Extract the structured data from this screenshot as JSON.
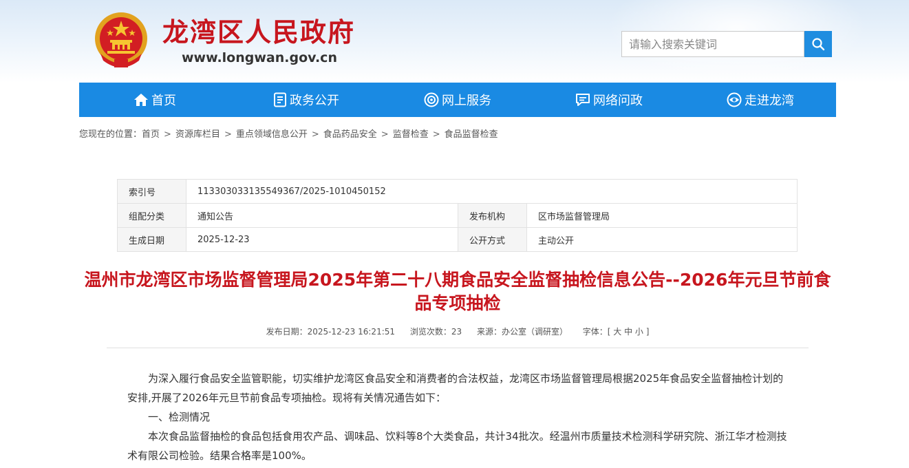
{
  "header": {
    "site_title": "龙湾区人民政府",
    "site_url": "www.longwan.gov.cn"
  },
  "search": {
    "placeholder": "请输入搜索关键词"
  },
  "nav": {
    "items": [
      {
        "label": "首页",
        "icon": "home-icon"
      },
      {
        "label": "政务公开",
        "icon": "document-icon"
      },
      {
        "label": "网上服务",
        "icon": "service-icon"
      },
      {
        "label": "网络问政",
        "icon": "chat-icon"
      },
      {
        "label": "走进龙湾",
        "icon": "eye-icon"
      }
    ]
  },
  "breadcrumb": {
    "prefix": "您现在的位置：",
    "items": [
      "首页",
      "资源库栏目",
      "重点领域信息公开",
      "食品药品安全",
      "监督检查",
      "食品监督检查"
    ],
    "separator": ">"
  },
  "meta": {
    "index_label": "索引号",
    "index_value": "113303033135549367/2025-1010450152",
    "category_label": "组配分类",
    "category_value": "通知公告",
    "publisher_label": "发布机构",
    "publisher_value": "区市场监督管理局",
    "date_label": "生成日期",
    "date_value": "2025-12-23",
    "method_label": "公开方式",
    "method_value": "主动公开"
  },
  "article": {
    "title": "温州市龙湾区市场监督管理局2025年第二十八期食品安全监督抽检信息公告--2026年元旦节前食品专项抽检",
    "publish_date": "发布日期：2025-12-23 16:21:51",
    "views": "浏览次数：23",
    "source": "来源：办公室（调研室）",
    "font_label": "字体：[ 大 中 小 ]",
    "paragraphs": [
      "为深入履行食品安全监管职能，切实维护龙湾区食品安全和消费者的合法权益，龙湾区市场监督管理局根据2025年食品安全监督抽检计划的安排,开展了2026年元旦节前食品专项抽检。现将有关情况通告如下：",
      "一、检测情况",
      "本次食品监督抽检的食品包括食用农产品、调味品、饮料等8个大类食品，共计34批次。经温州市质量技术检测科学研究院、浙江华才检测技术有限公司检验。结果合格率是100%。"
    ]
  },
  "colors": {
    "brand_red": "#c7161e",
    "nav_blue": "#1a8ae3",
    "search_blue": "#1f8de0"
  }
}
